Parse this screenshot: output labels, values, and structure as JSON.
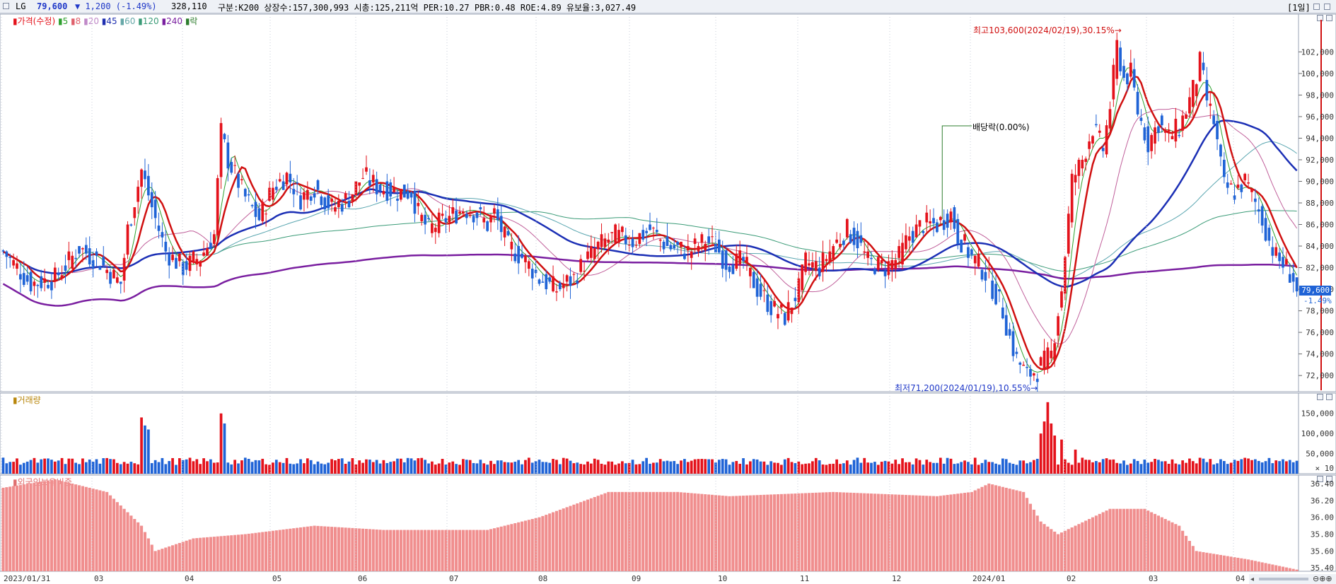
{
  "header": {
    "name": "LG",
    "price": "79,600",
    "change": "▼ 1,200 (-1.49%)",
    "volume": "328,110",
    "info": "구분:K200 상장수:157,300,993 시총:125,211억 PER:10.27 PBR:0.48 ROE:4.89 유보율:3,027.49",
    "period": "[1일]"
  },
  "legend": {
    "price_prefix": "▮가격(수정)",
    "ma_items": [
      {
        "label": "▮5",
        "color": "#2ea02e"
      },
      {
        "label": "▮8",
        "color": "#e0606c"
      },
      {
        "label": "▮20",
        "color": "#c089c8"
      },
      {
        "label": "▮45",
        "color": "#1f2fb0"
      },
      {
        "label": "▮60",
        "color": "#66a8a8"
      },
      {
        "label": "▮120",
        "color": "#3a9b77"
      },
      {
        "label": "▮240",
        "color": "#7a1fa0"
      },
      {
        "label": "▮락",
        "color": "#2e7d2e"
      }
    ],
    "volume": "▮거래량",
    "foreign": "▮외국인보유비중"
  },
  "annotations": {
    "high": "최고103,600(2024/02/19),30.15%→",
    "low": "최저71,200(2024/01/19),10.55%→",
    "dividend": "배당락(0.00%)"
  },
  "price_tag": {
    "price": "79,600",
    "pct": "-1.49%"
  },
  "colors": {
    "up": "#e4121b",
    "down": "#1f63d6",
    "ma45": "#1b2fb5",
    "ma240": "#7a1fa0",
    "ma5": "#2ea02e",
    "ma8": "#d01010",
    "ma20": "#c05f9a",
    "ma120": "#3a9b77",
    "ma60": "#5aa6b0",
    "foreign": "#f08e8e"
  },
  "chart_data": {
    "type": "candlestick",
    "title": "LG",
    "x_ticks": [
      "2023/01/31",
      "03",
      "04",
      "05",
      "06",
      "07",
      "08",
      "09",
      "10",
      "11",
      "12",
      "2024/01",
      "02",
      "03",
      "04"
    ],
    "price_ticks": [
      "72,000",
      "74,000",
      "76,000",
      "78,000",
      "80,000",
      "82,000",
      "84,000",
      "86,000",
      "88,000",
      "90,000",
      "92,000",
      "94,000",
      "96,000",
      "98,000",
      "100,000",
      "102,000"
    ],
    "volume_ticks": [
      "50,000",
      "100,000",
      "150,000"
    ],
    "volume_unit": "× 10",
    "foreign_ticks": [
      "35.40",
      "35.60",
      "35.80",
      "36.00",
      "36.20",
      "36.40"
    ],
    "close_anchors": [
      [
        0,
        83500
      ],
      [
        8,
        80500
      ],
      [
        15,
        81000
      ],
      [
        22,
        83800
      ],
      [
        28,
        82500
      ],
      [
        34,
        80500
      ],
      [
        36,
        85500
      ],
      [
        40,
        91000
      ],
      [
        44,
        86500
      ],
      [
        47,
        83500
      ],
      [
        52,
        82000
      ],
      [
        57,
        83000
      ],
      [
        61,
        85000
      ],
      [
        63,
        94500
      ],
      [
        65,
        92000
      ],
      [
        70,
        88500
      ],
      [
        74,
        86500
      ],
      [
        78,
        89500
      ],
      [
        82,
        90500
      ],
      [
        86,
        88500
      ],
      [
        90,
        89500
      ],
      [
        95,
        87500
      ],
      [
        100,
        88500
      ],
      [
        104,
        90500
      ],
      [
        108,
        89500
      ],
      [
        114,
        89000
      ],
      [
        118,
        89000
      ],
      [
        120,
        87000
      ],
      [
        123,
        85500
      ],
      [
        128,
        86500
      ],
      [
        133,
        87500
      ],
      [
        137,
        87000
      ],
      [
        140,
        86000
      ],
      [
        142,
        87000
      ],
      [
        146,
        84000
      ],
      [
        150,
        83000
      ],
      [
        155,
        81000
      ],
      [
        160,
        80000
      ],
      [
        165,
        81000
      ],
      [
        168,
        82500
      ],
      [
        172,
        84000
      ],
      [
        177,
        85000
      ],
      [
        182,
        84500
      ],
      [
        187,
        85500
      ],
      [
        192,
        84000
      ],
      [
        198,
        83500
      ],
      [
        203,
        84500
      ],
      [
        206,
        84000
      ],
      [
        209,
        82500
      ],
      [
        214,
        82500
      ],
      [
        218,
        80000
      ],
      [
        223,
        78000
      ],
      [
        226,
        77500
      ],
      [
        230,
        80000
      ],
      [
        232,
        82500
      ],
      [
        236,
        82000
      ],
      [
        240,
        84000
      ],
      [
        244,
        85500
      ],
      [
        247,
        84500
      ],
      [
        250,
        82500
      ],
      [
        255,
        82000
      ],
      [
        259,
        83000
      ],
      [
        262,
        85000
      ],
      [
        266,
        86000
      ],
      [
        270,
        86000
      ],
      [
        274,
        87000
      ],
      [
        276,
        85000
      ],
      [
        280,
        83000
      ],
      [
        284,
        81500
      ],
      [
        287,
        79500
      ],
      [
        289,
        78000
      ],
      [
        291,
        75500
      ],
      [
        293,
        73500
      ],
      [
        296,
        72000
      ],
      [
        299,
        72500
      ],
      [
        303,
        74000
      ],
      [
        306,
        80000
      ],
      [
        309,
        90000
      ],
      [
        312,
        92000
      ],
      [
        315,
        95000
      ],
      [
        318,
        93000
      ],
      [
        320,
        97000
      ],
      [
        322,
        102500
      ],
      [
        324,
        99500
      ],
      [
        326,
        100000
      ],
      [
        328,
        96500
      ],
      [
        331,
        93500
      ],
      [
        334,
        95500
      ],
      [
        337,
        94000
      ],
      [
        340,
        95000
      ],
      [
        343,
        97500
      ],
      [
        345,
        99500
      ],
      [
        346,
        101000
      ],
      [
        348,
        97500
      ],
      [
        350,
        95500
      ],
      [
        353,
        89500
      ],
      [
        356,
        89000
      ],
      [
        359,
        90000
      ],
      [
        362,
        88000
      ],
      [
        364,
        86500
      ],
      [
        366,
        84500
      ],
      [
        368,
        83000
      ],
      [
        371,
        82000
      ],
      [
        373,
        81000
      ],
      [
        374,
        79600
      ]
    ],
    "last_close": 79600,
    "high": {
      "price": 103600,
      "date": "2024/02/19"
    },
    "low": {
      "price": 71200,
      "date": "2024/01/19"
    }
  }
}
